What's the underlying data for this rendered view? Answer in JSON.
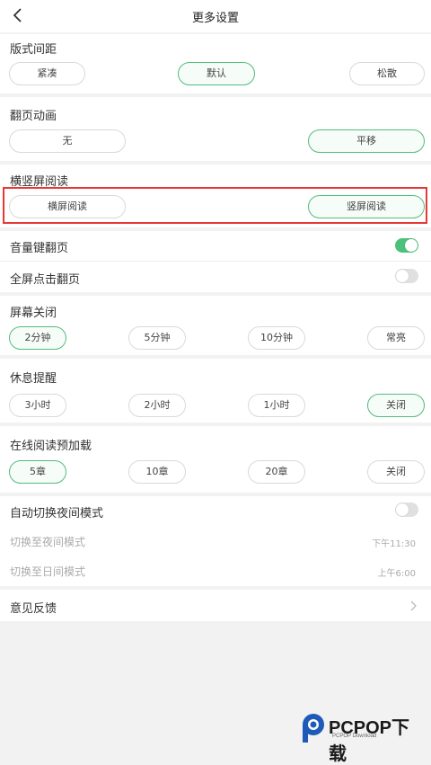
{
  "header": {
    "title": "更多设置"
  },
  "layout_spacing": {
    "label": "版式间距",
    "options": [
      "紧凑",
      "默认",
      "松散"
    ],
    "selected": "默认"
  },
  "page_animation": {
    "label": "翻页动画",
    "options": [
      "无",
      "平移"
    ],
    "selected": "平移"
  },
  "orientation": {
    "label": "横竖屏阅读",
    "options": [
      "横屏阅读",
      "竖屏阅读"
    ],
    "selected": "竖屏阅读"
  },
  "volume_key_flip": {
    "label": "音量键翻页",
    "enabled": true
  },
  "fullscreen_tap_flip": {
    "label": "全屏点击翻页",
    "enabled": false
  },
  "screen_off": {
    "label": "屏幕关闭",
    "options": [
      "2分钟",
      "5分钟",
      "10分钟",
      "常亮"
    ],
    "selected": "2分钟"
  },
  "rest_reminder": {
    "label": "休息提醒",
    "options": [
      "3小时",
      "2小时",
      "1小时",
      "关闭"
    ],
    "selected": "关闭"
  },
  "preload": {
    "label": "在线阅读预加载",
    "options": [
      "5章",
      "10章",
      "20章",
      "关闭"
    ],
    "selected": "5章"
  },
  "night_mode": {
    "auto_label": "自动切换夜间模式",
    "auto_enabled": false,
    "to_night_label": "切换至夜间模式",
    "to_night_time": "下午11:30",
    "to_day_label": "切换至日间模式",
    "to_day_time": "上午6:00"
  },
  "feedback": {
    "label": "意见反馈"
  },
  "watermark": {
    "brand": "PCPOP下载",
    "sub": "PCPOP Download"
  },
  "colors": {
    "accent": "#55bb7d",
    "toggle_on": "#4cc17a",
    "highlight": "#e53935"
  }
}
